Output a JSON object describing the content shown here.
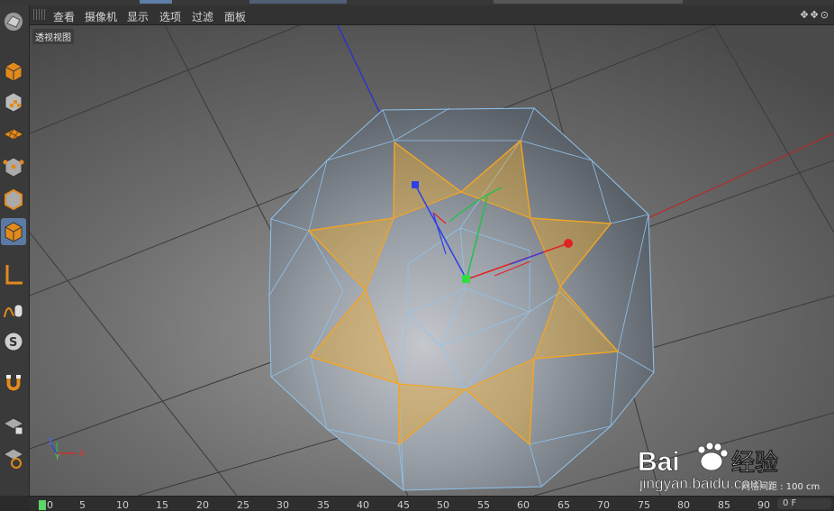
{
  "menubar": {
    "items": [
      "查看",
      "摄像机",
      "显示",
      "选项",
      "过滤",
      "面板"
    ],
    "nav_icons": "✥✥⊙"
  },
  "viewport": {
    "label": "透视视图",
    "grid_info": "网格间距 : 100 cm",
    "axis_labels": {
      "x": "X",
      "y": "Y",
      "z": "Z"
    }
  },
  "sidebar": {
    "tools": [
      {
        "name": "make-editable-icon"
      },
      {
        "name": "model-mode-icon"
      },
      {
        "name": "texture-mode-icon"
      },
      {
        "name": "workplane-mode-icon"
      },
      {
        "name": "points-mode-icon"
      },
      {
        "name": "edges-mode-icon"
      },
      {
        "name": "polygons-mode-icon",
        "active": true
      },
      {
        "name": "axis-mode-icon"
      },
      {
        "name": "tweak-mode-icon"
      },
      {
        "name": "solo-icon"
      },
      {
        "name": "snap-magnet-icon"
      },
      {
        "name": "workplane-lock-icon"
      },
      {
        "name": "planar-workplane-icon"
      }
    ]
  },
  "timeline": {
    "ticks": [
      "0",
      "5",
      "10",
      "15",
      "20",
      "25",
      "30",
      "35",
      "40",
      "45",
      "50",
      "55",
      "60",
      "65",
      "70",
      "75",
      "80",
      "85",
      "90"
    ],
    "current_frame": "0",
    "frame_field": "0 F"
  },
  "watermark": {
    "brand": "Bai",
    "brand_suffix": "经验",
    "url": "jingyan.baidu.com"
  },
  "colors": {
    "accent": "#5b7aa3",
    "selection": "#f2a526",
    "wireframe": "#8fc3ee",
    "x_axis": "#d92c2c",
    "y_axis": "#34c85a",
    "z_axis": "#3550ee"
  }
}
